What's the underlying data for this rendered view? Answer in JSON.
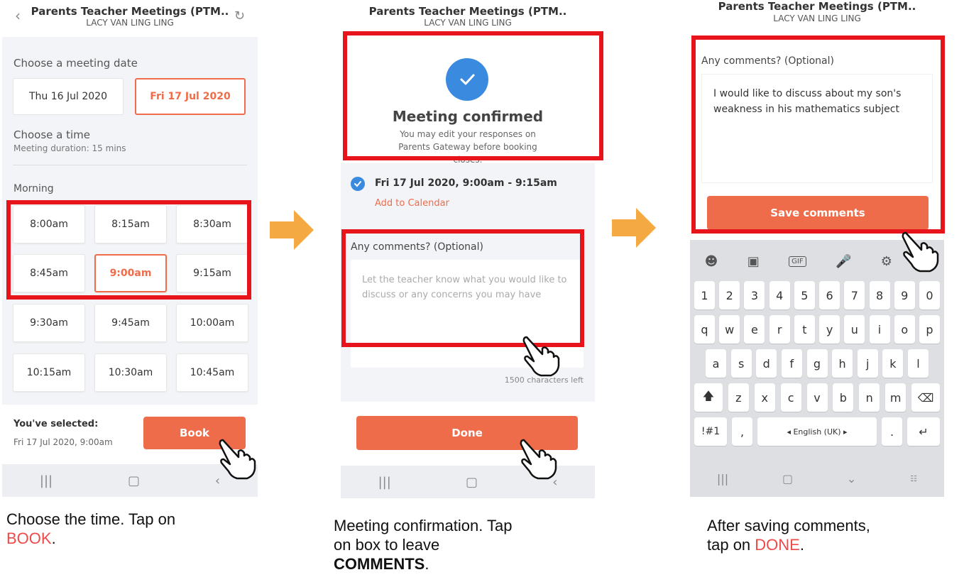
{
  "panel1": {
    "title": "Parents Teacher Meetings (PTM..",
    "subtitle": "LACY VAN LING LING",
    "choose_date_label": "Choose a meeting date",
    "dates": [
      "Thu 16 Jul 2020",
      "Fri 17 Jul 2020"
    ],
    "choose_time_label": "Choose a time",
    "duration_label": "Meeting duration: 15 mins",
    "morning_label": "Morning",
    "slots": [
      "8:00am",
      "8:15am",
      "8:30am",
      "8:45am",
      "9:00am",
      "9:15am",
      "9:30am",
      "9:45am",
      "10:00am",
      "10:15am",
      "10:30am",
      "10:45am"
    ],
    "selected_label": "You've selected:",
    "selected_value": "Fri 17 Jul 2020, 9:00am",
    "book_label": "Book"
  },
  "panel2": {
    "title": "Parents Teacher Meetings (PTM..",
    "subtitle": "LACY VAN LING LING",
    "confirmed_heading": "Meeting confirmed",
    "confirmed_note": "You may edit your responses on Parents Gateway before booking closes.",
    "booking": "Fri 17 Jul 2020, 9:00am - 9:15am",
    "add_calendar": "Add to Calendar",
    "comments_label": "Any comments? (Optional)",
    "comments_placeholder": "Let the teacher know what you would like to discuss or any concerns you may have",
    "chars_left": "1500 characters left",
    "done_label": "Done"
  },
  "panel3": {
    "title": "Parents Teacher Meetings (PTM..",
    "subtitle": "LACY VAN LING LING",
    "comments_label": "Any comments? (Optional)",
    "comment_text": "I would like to discuss about my son's weakness in his mathematics subject",
    "save_label": "Save comments",
    "keyboard": {
      "number_row": [
        "1",
        "2",
        "3",
        "4",
        "5",
        "6",
        "7",
        "8",
        "9",
        "0"
      ],
      "row1": [
        "q",
        "w",
        "e",
        "r",
        "t",
        "y",
        "u",
        "i",
        "o",
        "p"
      ],
      "row2": [
        "a",
        "s",
        "d",
        "f",
        "g",
        "h",
        "j",
        "k",
        "l"
      ],
      "row3": [
        "z",
        "x",
        "c",
        "v",
        "b",
        "n",
        "m"
      ],
      "symbols_key": "!#1",
      "comma_key": ",",
      "space_label": "◂ English (UK) ▸",
      "period_key": "."
    }
  },
  "captions": {
    "c1_text": "Choose the time. Tap on",
    "c1_highlight": "BOOK",
    "c1_end": ".",
    "c2_text1": "Meeting confirmation. Tap",
    "c2_text2": "on box to leave",
    "c2_bold": "COMMENTS",
    "c2_end": ".",
    "c3_text1": "After saving comments,",
    "c3_text2": "tap on ",
    "c3_highlight": "DONE",
    "c3_end": "."
  },
  "colors": {
    "accent": "#ef6c4a",
    "highlight_box": "#e8141c",
    "check_blue": "#3a8be0",
    "arrow": "#f5a942"
  },
  "icons": [
    "back-icon",
    "refresh-icon",
    "check-icon",
    "hand-pointer-icon",
    "arrow-right-icon",
    "emoji-icon",
    "sticker-icon",
    "gif-icon",
    "mic-icon",
    "settings-icon",
    "shift-icon",
    "backspace-icon",
    "enter-icon"
  ]
}
